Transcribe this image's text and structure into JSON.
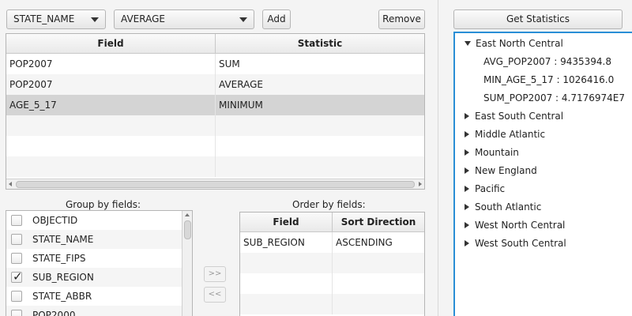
{
  "toolbar": {
    "field_combo": "STATE_NAME",
    "stat_combo": "AVERAGE",
    "add_label": "Add",
    "remove_label": "Remove",
    "get_stats_label": "Get Statistics"
  },
  "stats_table": {
    "headers": [
      "Field",
      "Statistic"
    ],
    "rows": [
      {
        "field": "POP2007",
        "statistic": "SUM"
      },
      {
        "field": "POP2007",
        "statistic": "AVERAGE"
      },
      {
        "field": "AGE_5_17",
        "statistic": "MINIMUM"
      }
    ]
  },
  "group_by": {
    "caption": "Group by fields:",
    "items": [
      {
        "label": "OBJECTID",
        "checked": false
      },
      {
        "label": "STATE_NAME",
        "checked": false
      },
      {
        "label": "STATE_FIPS",
        "checked": false
      },
      {
        "label": "SUB_REGION",
        "checked": true
      },
      {
        "label": "STATE_ABBR",
        "checked": false
      },
      {
        "label": "POP2000",
        "checked": false
      }
    ]
  },
  "move_buttons": {
    "right": ">>",
    "left": "<<"
  },
  "order_by": {
    "caption": "Order by fields:",
    "headers": [
      "Field",
      "Sort Direction"
    ],
    "rows": [
      {
        "field": "SUB_REGION",
        "direction": "ASCENDING"
      }
    ]
  },
  "tree": {
    "nodes": [
      {
        "label": "East North Central",
        "expanded": true,
        "children": [
          "AVG_POP2007 : 9435394.8",
          "MIN_AGE_5_17 : 1026416.0",
          "SUM_POP2007 : 4.7176974E7"
        ]
      },
      {
        "label": "East South Central",
        "expanded": false
      },
      {
        "label": "Middle Atlantic",
        "expanded": false
      },
      {
        "label": "Mountain",
        "expanded": false
      },
      {
        "label": "New England",
        "expanded": false
      },
      {
        "label": "Pacific",
        "expanded": false
      },
      {
        "label": "South Atlantic",
        "expanded": false
      },
      {
        "label": "West North Central",
        "expanded": false
      },
      {
        "label": "West South Central",
        "expanded": false
      }
    ]
  },
  "colors": {
    "focus_border": "#2a8fd6",
    "selected_row": "#d4d4d4"
  }
}
